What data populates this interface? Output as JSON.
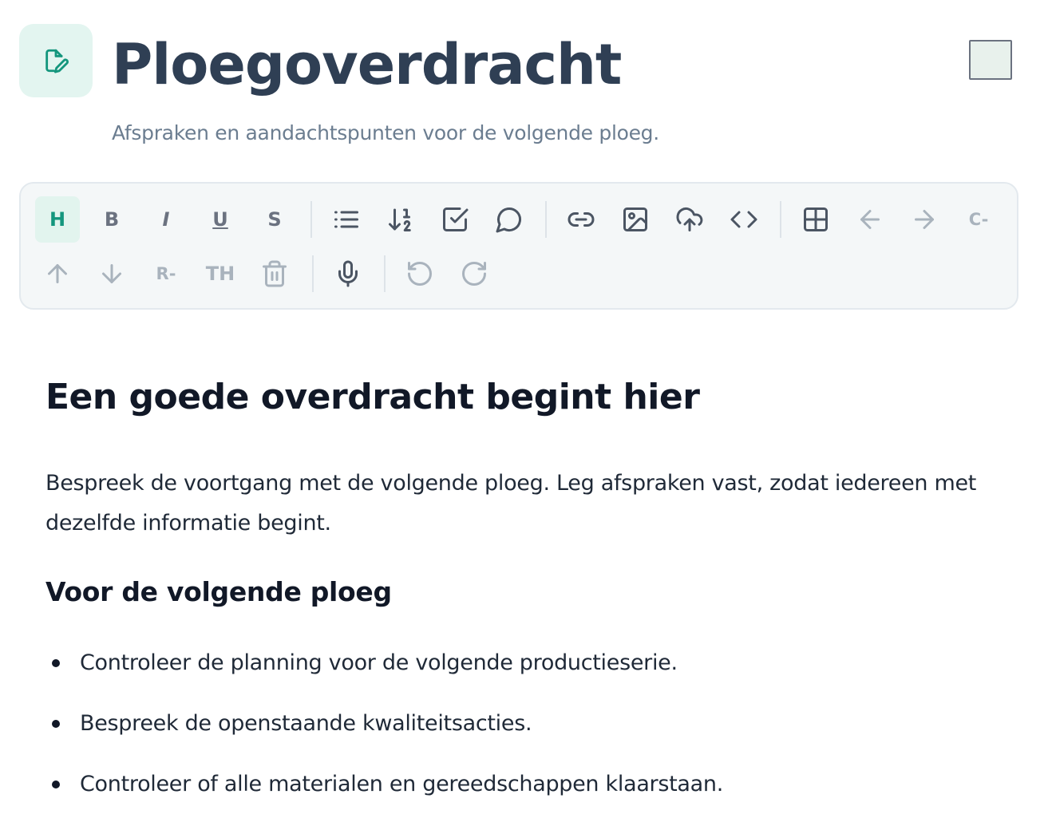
{
  "header": {
    "title": "Ploegoverdracht",
    "subtitle": "Afspraken en aandachtspunten voor de volgende ploeg.",
    "app_icon": "edit-note-icon",
    "swatch_color": "#e8f1ec"
  },
  "toolbar": {
    "heading_label": "H",
    "bold_label": "B",
    "italic_label": "I",
    "underline_label": "U",
    "strike_label": "S",
    "delete_column_label": "C-",
    "delete_row_label": "R-",
    "table_header_label": "TH",
    "icons": [
      "bullet-list-icon",
      "numbered-list-icon",
      "checklist-icon",
      "comment-icon",
      "link-icon",
      "image-icon",
      "upload-icon",
      "code-icon",
      "table-icon",
      "arrow-left-icon",
      "arrow-right-icon",
      "arrow-up-icon",
      "arrow-down-icon",
      "trash-icon",
      "microphone-icon",
      "undo-icon",
      "redo-icon"
    ],
    "accent_color": "#14967d"
  },
  "document": {
    "heading": "Een goede overdracht begint hier",
    "paragraph": "Bespreek de voortgang met de volgende ploeg. Leg afspraken vast, zodat iedereen met dezelfde informatie begint.",
    "subheading": "Voor de volgende ploeg",
    "items": [
      "Controleer de planning voor de volgende productieserie.",
      "Bespreek de openstaande kwaliteitsacties.",
      "Controleer of alle materialen en gereedschappen klaarstaan."
    ]
  }
}
